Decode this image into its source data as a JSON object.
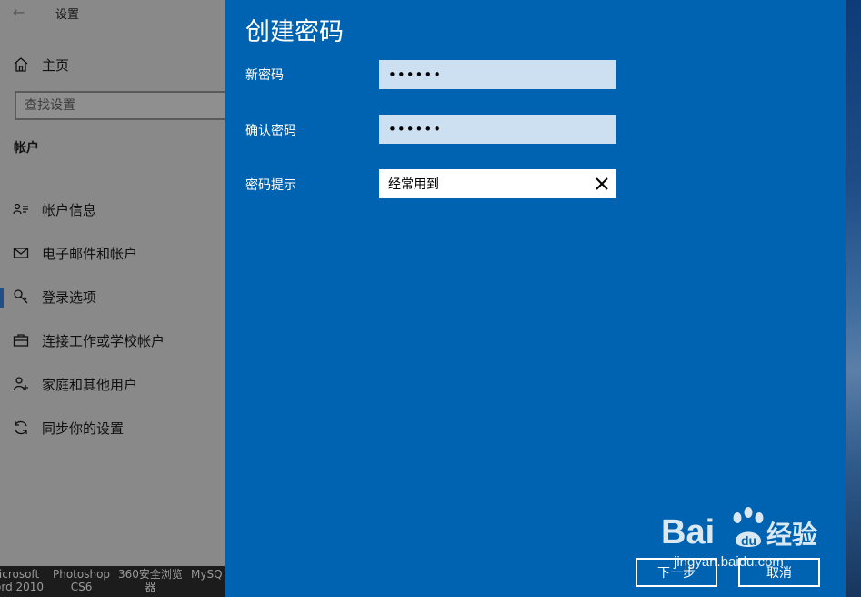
{
  "settings": {
    "title": "设置",
    "home_label": "主页",
    "search_placeholder": "查找设置",
    "section": "帐户",
    "nav": [
      {
        "label": "帐户信息",
        "icon": "contact-card-icon"
      },
      {
        "label": "电子邮件和帐户",
        "icon": "mail-icon"
      },
      {
        "label": "登录选项",
        "icon": "key-icon",
        "active": true
      },
      {
        "label": "连接工作或学校帐户",
        "icon": "briefcase-icon"
      },
      {
        "label": "家庭和其他用户",
        "icon": "add-person-icon"
      },
      {
        "label": "同步你的设置",
        "icon": "sync-icon"
      }
    ]
  },
  "taskbar": {
    "items": [
      "icrosoft\nord 2010",
      "Photoshop\nCS6",
      "360安全浏览\n器",
      "MySQ"
    ]
  },
  "dialog": {
    "title": "创建密码",
    "new_password_label": "新密码",
    "new_password_value": "••••••",
    "confirm_password_label": "确认密码",
    "confirm_password_value": "••••••",
    "hint_label": "密码提示",
    "hint_value": "经常用到",
    "next_label": "下一步",
    "cancel_label": "取消"
  },
  "watermark": {
    "logo_text": "Bai du 经验",
    "url": "jingyan.baidu.com"
  },
  "colors": {
    "dialog_bg": "#0063b1",
    "password_field_bg": "#cce0f2",
    "settings_dimmed_bg": "#898989"
  }
}
